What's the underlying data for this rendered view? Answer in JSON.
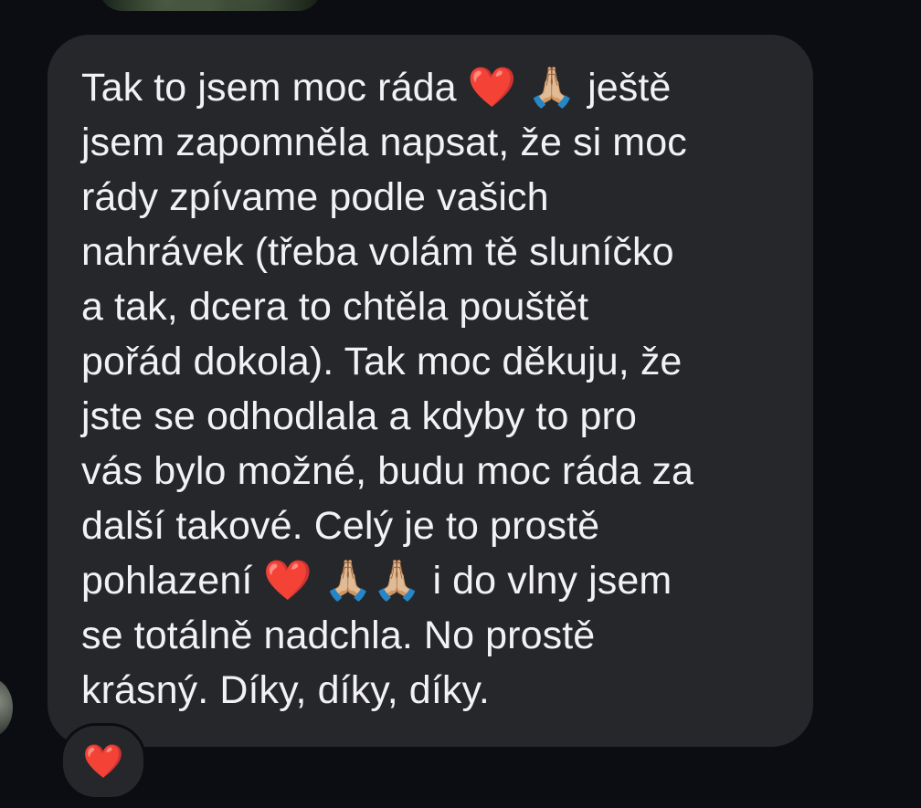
{
  "message": {
    "text": "Tak to jsem moc ráda ❤️ 🙏🏼 ještě\njsem zapomněla napsat, že si moc\nrády zpívame podle vašich\nnahrávek (třeba volám tě sluníčko\na tak, dcera to chtěla pouštět\npořád dokola). Tak moc děkuju, že\njste se odhodlala a kdyby to pro\nvás bylo možné, budu moc ráda za\ndalší takové. Celý je to prostě\npohlazení ❤️ 🙏🏼🙏🏼 i do vlny jsem\nse totálně nadchla. No prostě\nkrásný. Díky, díky, díky."
  },
  "reaction": {
    "emoji": "❤️"
  },
  "colors": {
    "background": "#0b0d12",
    "bubble": "#26272b",
    "text": "#f2f2f4"
  },
  "icons": {
    "avatar": "avatar-photo",
    "previous_attachment": "image-thumbnail"
  }
}
